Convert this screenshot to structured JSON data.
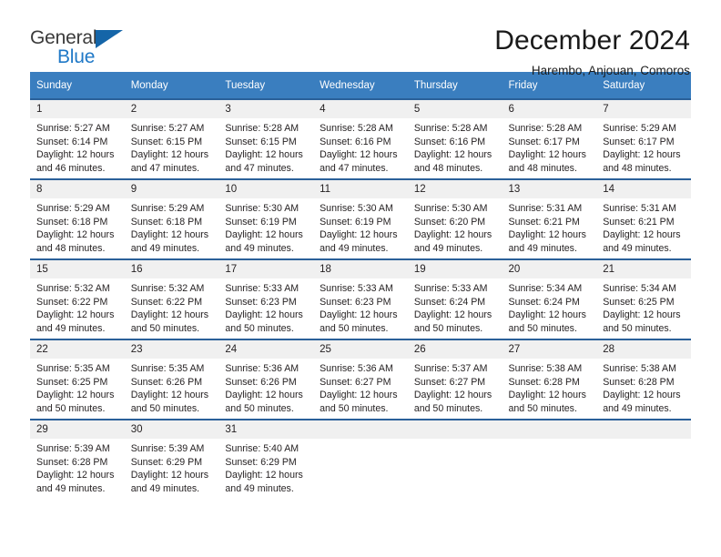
{
  "brand": {
    "logo_line1": "General",
    "logo_line2": "Blue",
    "accent_color": "#2079c7",
    "header_color": "#3a7ebf",
    "rule_color": "#2a6099"
  },
  "header": {
    "title": "December 2024",
    "subtitle": "Harembo, Anjouan, Comoros"
  },
  "calendar": {
    "weekdays": [
      "Sunday",
      "Monday",
      "Tuesday",
      "Wednesday",
      "Thursday",
      "Friday",
      "Saturday"
    ],
    "weeks": [
      [
        {
          "day": "1",
          "sunrise": "Sunrise: 5:27 AM",
          "sunset": "Sunset: 6:14 PM",
          "daylight1": "Daylight: 12 hours",
          "daylight2": "and 46 minutes."
        },
        {
          "day": "2",
          "sunrise": "Sunrise: 5:27 AM",
          "sunset": "Sunset: 6:15 PM",
          "daylight1": "Daylight: 12 hours",
          "daylight2": "and 47 minutes."
        },
        {
          "day": "3",
          "sunrise": "Sunrise: 5:28 AM",
          "sunset": "Sunset: 6:15 PM",
          "daylight1": "Daylight: 12 hours",
          "daylight2": "and 47 minutes."
        },
        {
          "day": "4",
          "sunrise": "Sunrise: 5:28 AM",
          "sunset": "Sunset: 6:16 PM",
          "daylight1": "Daylight: 12 hours",
          "daylight2": "and 47 minutes."
        },
        {
          "day": "5",
          "sunrise": "Sunrise: 5:28 AM",
          "sunset": "Sunset: 6:16 PM",
          "daylight1": "Daylight: 12 hours",
          "daylight2": "and 48 minutes."
        },
        {
          "day": "6",
          "sunrise": "Sunrise: 5:28 AM",
          "sunset": "Sunset: 6:17 PM",
          "daylight1": "Daylight: 12 hours",
          "daylight2": "and 48 minutes."
        },
        {
          "day": "7",
          "sunrise": "Sunrise: 5:29 AM",
          "sunset": "Sunset: 6:17 PM",
          "daylight1": "Daylight: 12 hours",
          "daylight2": "and 48 minutes."
        }
      ],
      [
        {
          "day": "8",
          "sunrise": "Sunrise: 5:29 AM",
          "sunset": "Sunset: 6:18 PM",
          "daylight1": "Daylight: 12 hours",
          "daylight2": "and 48 minutes."
        },
        {
          "day": "9",
          "sunrise": "Sunrise: 5:29 AM",
          "sunset": "Sunset: 6:18 PM",
          "daylight1": "Daylight: 12 hours",
          "daylight2": "and 49 minutes."
        },
        {
          "day": "10",
          "sunrise": "Sunrise: 5:30 AM",
          "sunset": "Sunset: 6:19 PM",
          "daylight1": "Daylight: 12 hours",
          "daylight2": "and 49 minutes."
        },
        {
          "day": "11",
          "sunrise": "Sunrise: 5:30 AM",
          "sunset": "Sunset: 6:19 PM",
          "daylight1": "Daylight: 12 hours",
          "daylight2": "and 49 minutes."
        },
        {
          "day": "12",
          "sunrise": "Sunrise: 5:30 AM",
          "sunset": "Sunset: 6:20 PM",
          "daylight1": "Daylight: 12 hours",
          "daylight2": "and 49 minutes."
        },
        {
          "day": "13",
          "sunrise": "Sunrise: 5:31 AM",
          "sunset": "Sunset: 6:21 PM",
          "daylight1": "Daylight: 12 hours",
          "daylight2": "and 49 minutes."
        },
        {
          "day": "14",
          "sunrise": "Sunrise: 5:31 AM",
          "sunset": "Sunset: 6:21 PM",
          "daylight1": "Daylight: 12 hours",
          "daylight2": "and 49 minutes."
        }
      ],
      [
        {
          "day": "15",
          "sunrise": "Sunrise: 5:32 AM",
          "sunset": "Sunset: 6:22 PM",
          "daylight1": "Daylight: 12 hours",
          "daylight2": "and 49 minutes."
        },
        {
          "day": "16",
          "sunrise": "Sunrise: 5:32 AM",
          "sunset": "Sunset: 6:22 PM",
          "daylight1": "Daylight: 12 hours",
          "daylight2": "and 50 minutes."
        },
        {
          "day": "17",
          "sunrise": "Sunrise: 5:33 AM",
          "sunset": "Sunset: 6:23 PM",
          "daylight1": "Daylight: 12 hours",
          "daylight2": "and 50 minutes."
        },
        {
          "day": "18",
          "sunrise": "Sunrise: 5:33 AM",
          "sunset": "Sunset: 6:23 PM",
          "daylight1": "Daylight: 12 hours",
          "daylight2": "and 50 minutes."
        },
        {
          "day": "19",
          "sunrise": "Sunrise: 5:33 AM",
          "sunset": "Sunset: 6:24 PM",
          "daylight1": "Daylight: 12 hours",
          "daylight2": "and 50 minutes."
        },
        {
          "day": "20",
          "sunrise": "Sunrise: 5:34 AM",
          "sunset": "Sunset: 6:24 PM",
          "daylight1": "Daylight: 12 hours",
          "daylight2": "and 50 minutes."
        },
        {
          "day": "21",
          "sunrise": "Sunrise: 5:34 AM",
          "sunset": "Sunset: 6:25 PM",
          "daylight1": "Daylight: 12 hours",
          "daylight2": "and 50 minutes."
        }
      ],
      [
        {
          "day": "22",
          "sunrise": "Sunrise: 5:35 AM",
          "sunset": "Sunset: 6:25 PM",
          "daylight1": "Daylight: 12 hours",
          "daylight2": "and 50 minutes."
        },
        {
          "day": "23",
          "sunrise": "Sunrise: 5:35 AM",
          "sunset": "Sunset: 6:26 PM",
          "daylight1": "Daylight: 12 hours",
          "daylight2": "and 50 minutes."
        },
        {
          "day": "24",
          "sunrise": "Sunrise: 5:36 AM",
          "sunset": "Sunset: 6:26 PM",
          "daylight1": "Daylight: 12 hours",
          "daylight2": "and 50 minutes."
        },
        {
          "day": "25",
          "sunrise": "Sunrise: 5:36 AM",
          "sunset": "Sunset: 6:27 PM",
          "daylight1": "Daylight: 12 hours",
          "daylight2": "and 50 minutes."
        },
        {
          "day": "26",
          "sunrise": "Sunrise: 5:37 AM",
          "sunset": "Sunset: 6:27 PM",
          "daylight1": "Daylight: 12 hours",
          "daylight2": "and 50 minutes."
        },
        {
          "day": "27",
          "sunrise": "Sunrise: 5:38 AM",
          "sunset": "Sunset: 6:28 PM",
          "daylight1": "Daylight: 12 hours",
          "daylight2": "and 50 minutes."
        },
        {
          "day": "28",
          "sunrise": "Sunrise: 5:38 AM",
          "sunset": "Sunset: 6:28 PM",
          "daylight1": "Daylight: 12 hours",
          "daylight2": "and 49 minutes."
        }
      ],
      [
        {
          "day": "29",
          "sunrise": "Sunrise: 5:39 AM",
          "sunset": "Sunset: 6:28 PM",
          "daylight1": "Daylight: 12 hours",
          "daylight2": "and 49 minutes."
        },
        {
          "day": "30",
          "sunrise": "Sunrise: 5:39 AM",
          "sunset": "Sunset: 6:29 PM",
          "daylight1": "Daylight: 12 hours",
          "daylight2": "and 49 minutes."
        },
        {
          "day": "31",
          "sunrise": "Sunrise: 5:40 AM",
          "sunset": "Sunset: 6:29 PM",
          "daylight1": "Daylight: 12 hours",
          "daylight2": "and 49 minutes."
        },
        {
          "day": "",
          "sunrise": "",
          "sunset": "",
          "daylight1": "",
          "daylight2": ""
        },
        {
          "day": "",
          "sunrise": "",
          "sunset": "",
          "daylight1": "",
          "daylight2": ""
        },
        {
          "day": "",
          "sunrise": "",
          "sunset": "",
          "daylight1": "",
          "daylight2": ""
        },
        {
          "day": "",
          "sunrise": "",
          "sunset": "",
          "daylight1": "",
          "daylight2": ""
        }
      ]
    ]
  }
}
